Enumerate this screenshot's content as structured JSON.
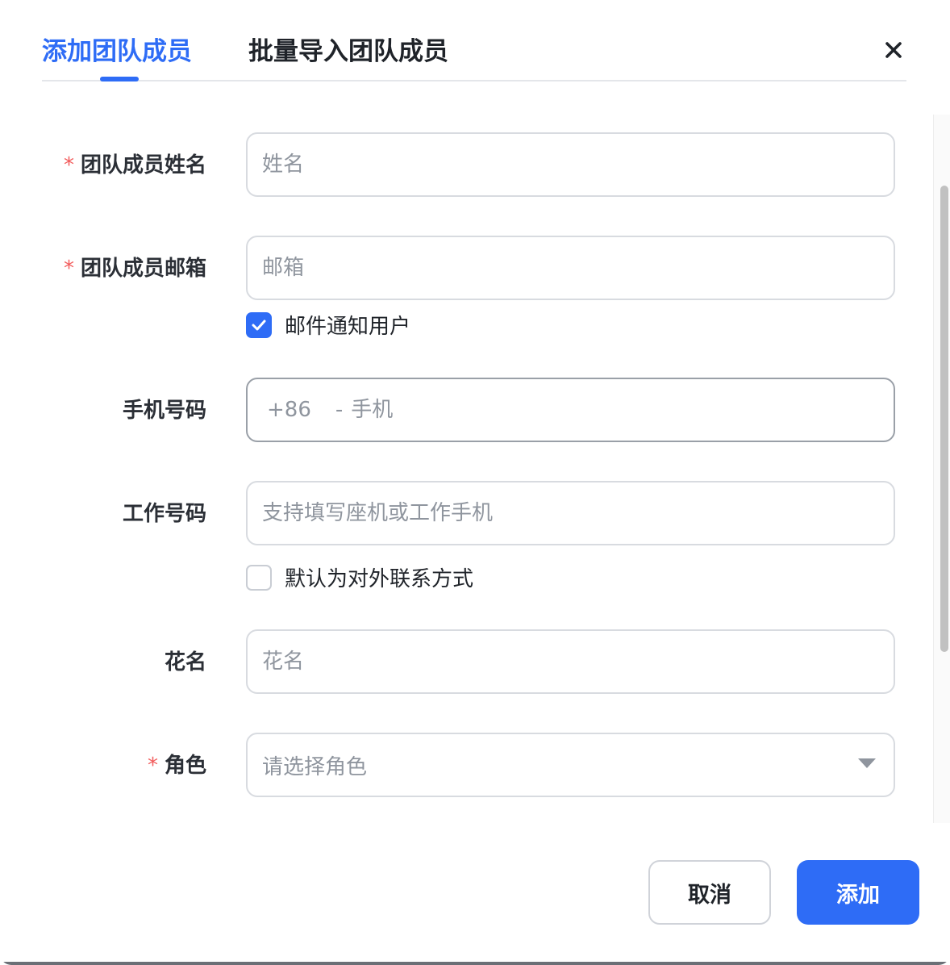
{
  "tabs": [
    {
      "label": "添加团队成员",
      "active": true
    },
    {
      "label": "批量导入团队成员",
      "active": false
    }
  ],
  "form": {
    "name": {
      "label": "团队成员姓名",
      "required": true,
      "placeholder": "姓名"
    },
    "email": {
      "label": "团队成员邮箱",
      "required": true,
      "placeholder": "邮箱"
    },
    "notify": {
      "label": "邮件通知用户",
      "checked": true
    },
    "phone": {
      "label": "手机号码",
      "country_code": "+86",
      "separator": "-",
      "placeholder": "手机"
    },
    "work_phone": {
      "label": "工作号码",
      "placeholder": "支持填写座机或工作手机"
    },
    "default_contact": {
      "label": "默认为对外联系方式",
      "checked": false
    },
    "nickname": {
      "label": "花名",
      "placeholder": "花名"
    },
    "role": {
      "label": "角色",
      "required": true,
      "placeholder": "请选择角色"
    }
  },
  "required_mark": "*",
  "footer": {
    "cancel_label": "取消",
    "submit_label": "添加"
  },
  "colors": {
    "primary": "#2e6cf6",
    "required": "#f25c5c"
  }
}
